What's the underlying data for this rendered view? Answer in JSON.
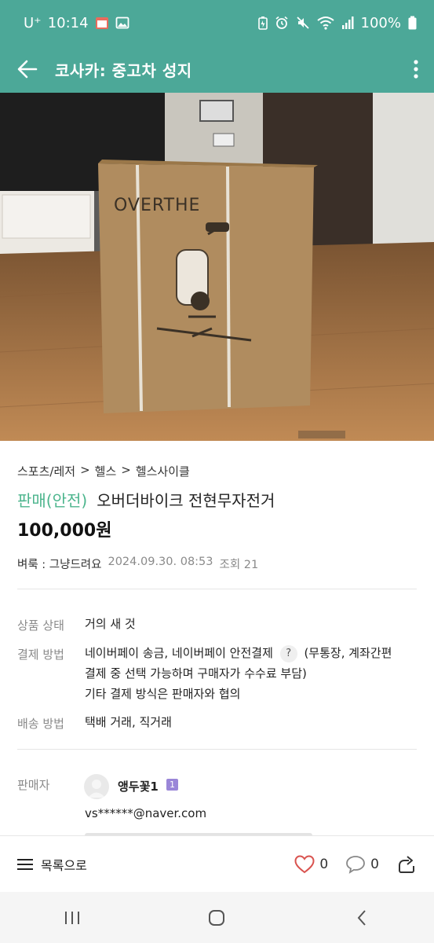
{
  "status_bar": {
    "carrier": "U⁺",
    "time": "10:14",
    "battery": "100%",
    "icons": [
      "calendar-icon",
      "gallery-icon",
      "battery-saver-icon",
      "alarm-icon",
      "mute-icon",
      "wifi-icon",
      "signal-icon",
      "battery-icon"
    ]
  },
  "app_bar": {
    "title": "코사카: 중고차 성지",
    "back_icon": "arrow-left-icon",
    "more_icon": "more-vertical-icon"
  },
  "breadcrumb": [
    "스포츠/레저",
    "헬스",
    "헬스사이클"
  ],
  "breadcrumb_sep": ">",
  "product": {
    "sale_status": "판매(안전)",
    "title": "오버더바이크 전현무자전거",
    "price": "100,000원"
  },
  "meta": {
    "author": "벼룩 : 그냥드려요",
    "date": "2024.09.30. 08:53",
    "views": "조회 21"
  },
  "info": {
    "condition_label": "상품 상태",
    "condition_value": "거의 새 것",
    "payment_label": "결제 방법",
    "payment_line1a": "네이버페이 송금, 네이버페이 안전결제",
    "payment_help": "?",
    "payment_line1b": "(무통장, 계좌간편",
    "payment_line2": "결제 중 선택 가능하며 구매자가 수수료 부담)",
    "payment_line3": "기타 결제 방식은 판매자와 협의",
    "delivery_label": "배송 방법",
    "delivery_value": "택배 거래, 직거래"
  },
  "seller": {
    "label": "판매자",
    "name": "앵두꽃1",
    "level": "1",
    "email": "vs******@naver.com"
  },
  "action_bar": {
    "list_label": "목록으로",
    "like_count": "0",
    "comment_count": "0",
    "icons": [
      "menu-icon",
      "heart-icon",
      "comment-icon",
      "share-icon"
    ]
  },
  "photo": {
    "box_brand": "OVERTHE"
  },
  "colors": {
    "header": "#4ca898",
    "sale_green": "#4cb58d",
    "like_red": "#d9534f"
  }
}
